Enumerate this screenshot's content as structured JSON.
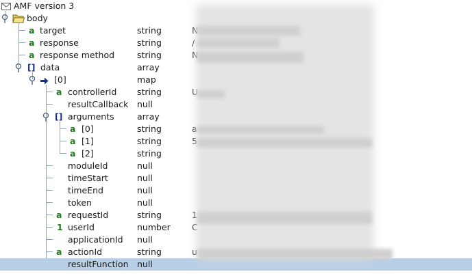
{
  "root": {
    "label": "AMF version 3",
    "icon": "envelope-icon"
  },
  "body": {
    "label": "body",
    "icon": "folder-open-icon"
  },
  "rows": [
    {
      "key": "target",
      "icon": "a",
      "type": "string",
      "value": "N"
    },
    {
      "key": "response",
      "icon": "a",
      "type": "string",
      "value": "/"
    },
    {
      "key": "response method",
      "icon": "a",
      "type": "string",
      "value": "N"
    },
    {
      "key": "data",
      "icon": "[]",
      "type": "array",
      "value": ""
    },
    {
      "key": "[0]",
      "icon": "arrow",
      "type": "map",
      "value": ""
    },
    {
      "key": "controllerId",
      "icon": "a",
      "type": "string",
      "value": "U"
    },
    {
      "key": "resultCallback",
      "icon": "",
      "type": "null",
      "value": ""
    },
    {
      "key": "arguments",
      "icon": "[]",
      "type": "array",
      "value": ""
    },
    {
      "key": "[0]",
      "icon": "a",
      "type": "string",
      "value": "a"
    },
    {
      "key": "[1]",
      "icon": "a",
      "type": "string",
      "value": "5"
    },
    {
      "key": "[2]",
      "icon": "a",
      "type": "string",
      "value": ""
    },
    {
      "key": "moduleId",
      "icon": "",
      "type": "null",
      "value": ""
    },
    {
      "key": "timeStart",
      "icon": "",
      "type": "null",
      "value": ""
    },
    {
      "key": "timeEnd",
      "icon": "",
      "type": "null",
      "value": ""
    },
    {
      "key": "token",
      "icon": "",
      "type": "null",
      "value": ""
    },
    {
      "key": "requestId",
      "icon": "a",
      "type": "string",
      "value": "1"
    },
    {
      "key": "userId",
      "icon": "1",
      "type": "number",
      "value": "C"
    },
    {
      "key": "applicationId",
      "icon": "",
      "type": "null",
      "value": ""
    },
    {
      "key": "actionId",
      "icon": "a",
      "type": "string",
      "value": "u"
    },
    {
      "key": "resultFunction",
      "icon": "",
      "type": "null",
      "value": ""
    }
  ],
  "selected_key": "resultFunction",
  "colors": {
    "selection": "#b8cfe5",
    "text_icon": "#1d7a1d",
    "array_icon": "#152f8c"
  }
}
